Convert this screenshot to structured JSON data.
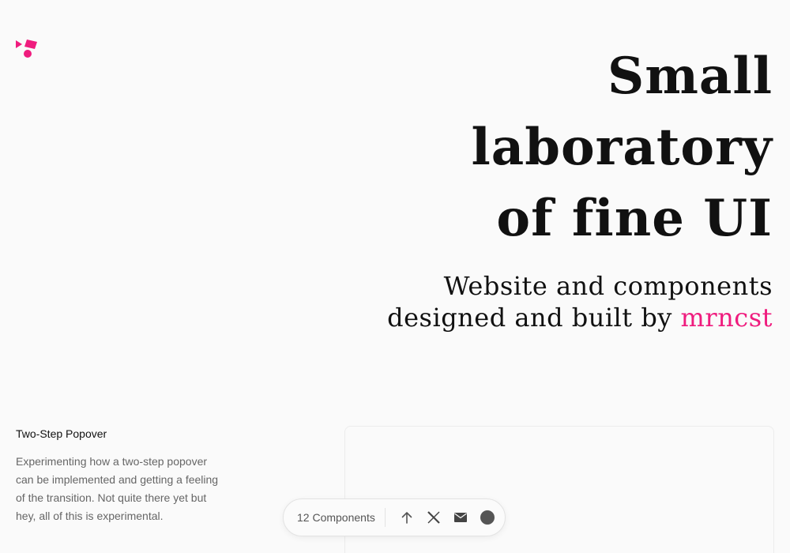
{
  "hero": {
    "title_line1": "Small laboratory",
    "title_line2": "of fine UI",
    "subtitle_prefix": "Website and components designed and built by ",
    "author": "mrncst"
  },
  "entry": {
    "title": "Two-Step Popover",
    "description": "Experimenting how a two-step popover can be implemented and getting a feeling of the transition. Not quite there yet but hey, all of this is experimental."
  },
  "dock": {
    "components_label": "12 Components",
    "icons": [
      "arrow-up-icon",
      "x-icon",
      "mail-icon",
      "theme-toggle-icon"
    ]
  },
  "colors": {
    "accent": "#ef1c7e",
    "text": "#111111",
    "muted": "#666666",
    "background": "#fafafa"
  }
}
